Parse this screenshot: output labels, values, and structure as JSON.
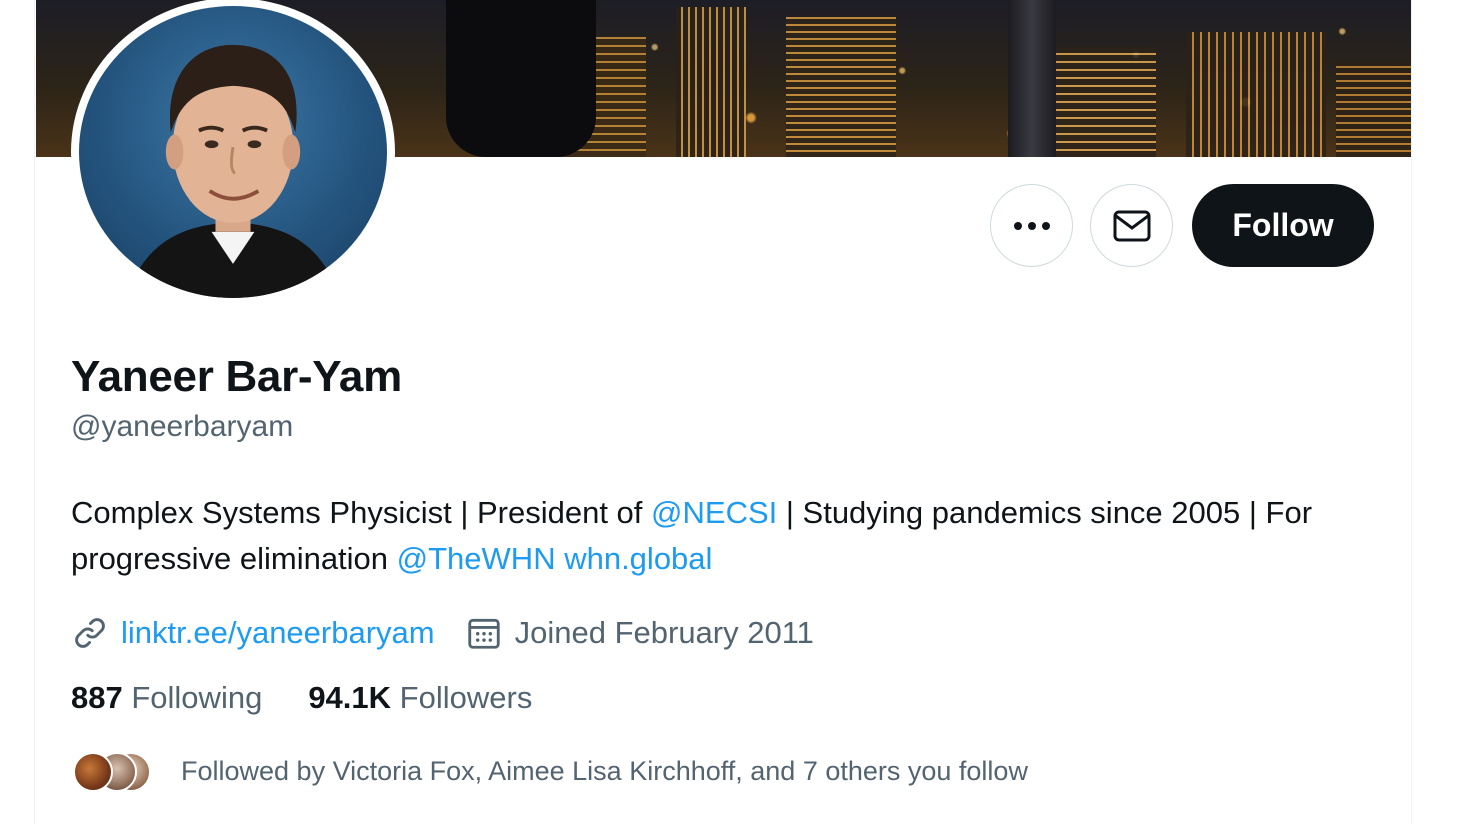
{
  "profile": {
    "display_name": "Yaneer Bar-Yam",
    "handle": "@yaneerbaryam",
    "bio": {
      "part1": "Complex Systems Physicist | President of ",
      "mention1": "@NECSI",
      "part2": " | Studying pandemics since 2005 | For progressive elimination ",
      "mention2": "@TheWHN",
      "space": " ",
      "website_inline": "whn.global"
    },
    "website": "linktr.ee/yaneerbaryam",
    "joined": "Joined February 2011"
  },
  "actions": {
    "follow_label": "Follow",
    "more_icon": "more-horizontal-icon",
    "message_icon": "envelope-icon"
  },
  "stats": {
    "following_count": "887",
    "following_label": "Following",
    "followers_count": "94.1K",
    "followers_label": "Followers"
  },
  "followed_by": {
    "text": "Followed by Victoria Fox, Aimee Lisa Kirchhoff, and 7 others you follow"
  },
  "colors": {
    "link": "#1d9bf0",
    "text_primary": "#0f1419",
    "text_secondary": "#536471",
    "follow_button_bg": "#0f1419"
  }
}
